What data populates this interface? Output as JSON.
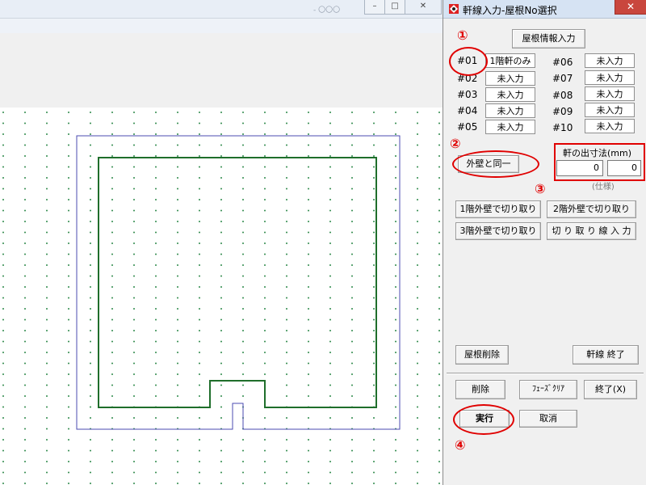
{
  "background": {
    "title_text": "- 〇〇〇",
    "window_buttons": [
      "–",
      "□",
      "✕"
    ]
  },
  "dialog": {
    "title": "軒線入力-屋根No選択",
    "close_glyph": "✕",
    "roof_info_button": "屋根情報入力",
    "roof_slots": [
      {
        "id": "#01",
        "value": "1階軒のみ"
      },
      {
        "id": "#02",
        "value": "未入力"
      },
      {
        "id": "#03",
        "value": "未入力"
      },
      {
        "id": "#04",
        "value": "未入力"
      },
      {
        "id": "#05",
        "value": "未入力"
      },
      {
        "id": "#06",
        "value": "未入力"
      },
      {
        "id": "#07",
        "value": "未入力"
      },
      {
        "id": "#08",
        "value": "未入力"
      },
      {
        "id": "#09",
        "value": "未入力"
      },
      {
        "id": "#10",
        "value": "未入力"
      }
    ],
    "same_as_wall_button": "外壁と同一",
    "eave_label": "軒の出寸法(mm)",
    "eave_value_1": "0",
    "eave_value_2": "0",
    "spec_label": "(仕様)",
    "cut_buttons": [
      "1階外壁で切り取り",
      "2階外壁で切り取り",
      "3階外壁で切り取り",
      "切 り 取 り 線 入 力"
    ],
    "roof_delete_button": "屋根削除",
    "eave_end_button": "軒線 終了",
    "delete_button": "削除",
    "phase_clear_button": "ﾌｪｰｽﾞｸﾘｱ",
    "end_button": "終了(X)",
    "execute_button": "実行",
    "cancel_button": "取消"
  },
  "annotations": [
    "①",
    "②",
    "③",
    "④"
  ],
  "colors": {
    "annotation": "#e00000",
    "wall_line": "#1f6e2b",
    "outer_line": "#4b4bb0",
    "grid_dot": "#2e8a4a",
    "close_button": "#c9463d"
  }
}
